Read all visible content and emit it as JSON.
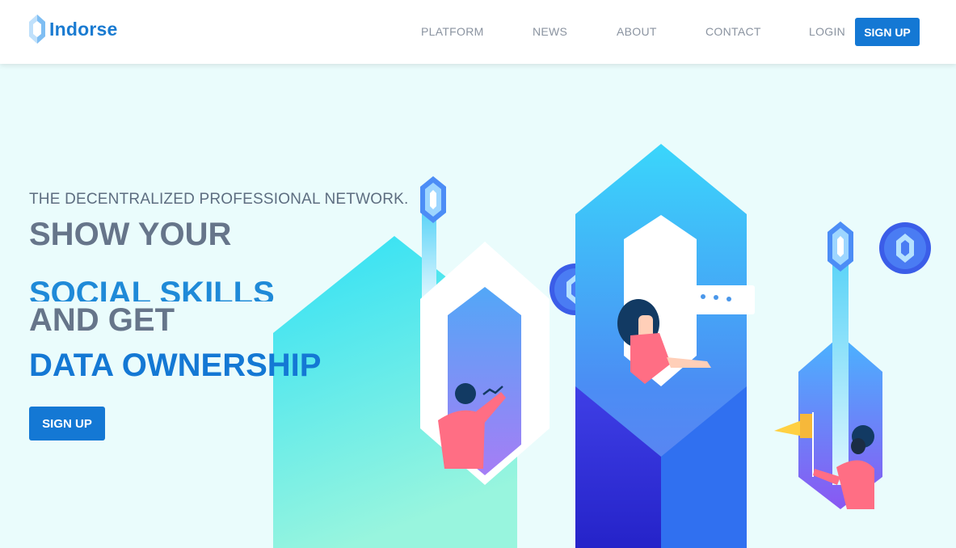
{
  "brand": {
    "name": "Indorse",
    "logo_icon": "indorse-hexagon-icon"
  },
  "nav": {
    "items": [
      {
        "label": "PLATFORM"
      },
      {
        "label": "NEWS"
      },
      {
        "label": "ABOUT"
      },
      {
        "label": "CONTACT"
      },
      {
        "label": "LOGIN"
      }
    ],
    "signup_label": "SIGN UP"
  },
  "hero": {
    "subtitle": "THE DECENTRALIZED PROFESSIONAL NETWORK.",
    "line1": "SHOW YOUR",
    "line2": "SOCIAL SKILLS",
    "line3": "AND GET",
    "line4": "DATA OWNERSHIP",
    "cta_label": "SIGN UP"
  },
  "colors": {
    "primary": "#1478d4",
    "background": "#eafcfc",
    "heading_gray": "#66758a",
    "accent_blue": "#1f8ad8"
  }
}
